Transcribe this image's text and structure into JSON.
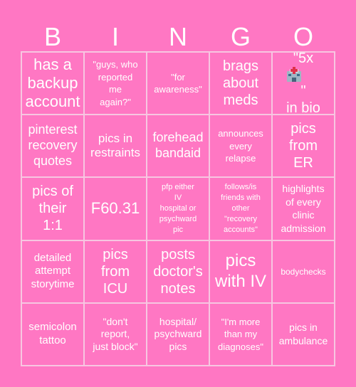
{
  "header": {
    "letters": [
      "B",
      "I",
      "N",
      "G",
      "O"
    ]
  },
  "colors": {
    "background": "#ff77c3",
    "grid_line": "#f7c6e1",
    "text": "#ffffff"
  },
  "card": {
    "rows": [
      [
        "has a backup account",
        "\"guys, who reported me again?\"",
        "\"for awareness\"",
        "brags about meds",
        "\"5x [hospital-emoji]\" in bio"
      ],
      [
        "pinterest recovery quotes",
        "pics in restraints",
        "forehead bandaid",
        "announces every relapse",
        "pics from ER"
      ],
      [
        "pics of their 1:1",
        "F60.31",
        "pfp either IV hospital or psychward pic",
        "follows/is friends with other \"recovery accounts\"",
        "highlights of every clinic admission"
      ],
      [
        "detailed attempt storytime",
        "pics from ICU",
        "posts doctor's notes",
        "pics with IV",
        "bodychecks"
      ],
      [
        "semicolon tattoo",
        "\"don't report, just block\"",
        "hospital/ psychward pics",
        "\"I'm more than my diagnoses\"",
        "pics in ambulance"
      ]
    ],
    "cells": {
      "r0c0": [
        "has a",
        "backup",
        "account"
      ],
      "r0c1": [
        "\"guys, who",
        "reported",
        "me",
        "again?\""
      ],
      "r0c2": [
        "\"for",
        "awareness\""
      ],
      "r0c3": [
        "brags",
        "about",
        "meds"
      ],
      "r0c4": {
        "before_icon": "\"5x",
        "icon": "hospital-emoji",
        "after_icon": "\"",
        "line2": "in bio"
      },
      "r1c0": [
        "pinterest",
        "recovery",
        "quotes"
      ],
      "r1c1": [
        "pics in",
        "restraints"
      ],
      "r1c2": [
        "forehead",
        "bandaid"
      ],
      "r1c3": [
        "announces",
        "every",
        "relapse"
      ],
      "r1c4": [
        "pics",
        "from",
        "ER"
      ],
      "r2c0": [
        "pics of",
        "their",
        "1:1"
      ],
      "r2c1": [
        "F60.31"
      ],
      "r2c2": [
        "pfp either",
        "IV",
        "hospital or",
        "psychward",
        "pic"
      ],
      "r2c3": [
        "follows/is",
        "friends with",
        "other",
        "\"recovery",
        "accounts\""
      ],
      "r2c4": [
        "highlights",
        "of every",
        "clinic",
        "admission"
      ],
      "r3c0": [
        "detailed",
        "attempt",
        "storytime"
      ],
      "r3c1": [
        "pics",
        "from",
        "ICU"
      ],
      "r3c2": [
        "posts",
        "doctor's",
        "notes"
      ],
      "r3c3": [
        "pics",
        "with IV"
      ],
      "r3c4": [
        "bodychecks"
      ],
      "r4c0": [
        "semicolon",
        "tattoo"
      ],
      "r4c1": [
        "\"don't",
        "report,",
        "just block\""
      ],
      "r4c2": [
        "hospital/",
        "psychward",
        "pics"
      ],
      "r4c3": [
        "\"I'm more",
        "than my",
        "diagnoses\""
      ],
      "r4c4": [
        "pics in",
        "ambulance"
      ]
    }
  }
}
